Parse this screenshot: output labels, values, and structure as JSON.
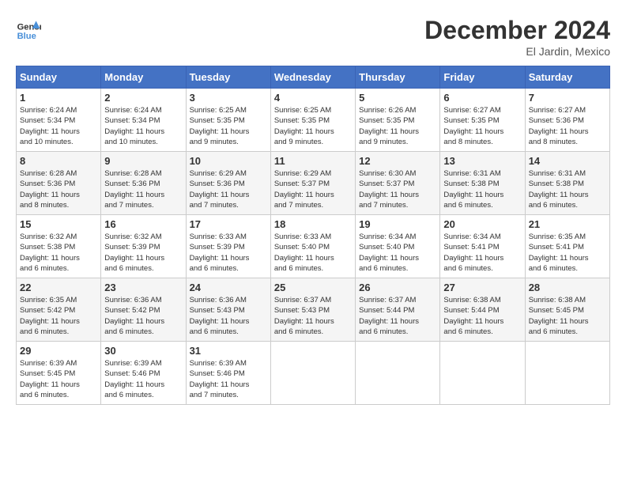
{
  "header": {
    "logo_line1": "General",
    "logo_line2": "Blue",
    "title": "December 2024",
    "subtitle": "El Jardin, Mexico"
  },
  "days_of_week": [
    "Sunday",
    "Monday",
    "Tuesday",
    "Wednesday",
    "Thursday",
    "Friday",
    "Saturday"
  ],
  "weeks": [
    [
      {
        "day": "1",
        "info": "Sunrise: 6:24 AM\nSunset: 5:34 PM\nDaylight: 11 hours\nand 10 minutes."
      },
      {
        "day": "2",
        "info": "Sunrise: 6:24 AM\nSunset: 5:34 PM\nDaylight: 11 hours\nand 10 minutes."
      },
      {
        "day": "3",
        "info": "Sunrise: 6:25 AM\nSunset: 5:35 PM\nDaylight: 11 hours\nand 9 minutes."
      },
      {
        "day": "4",
        "info": "Sunrise: 6:25 AM\nSunset: 5:35 PM\nDaylight: 11 hours\nand 9 minutes."
      },
      {
        "day": "5",
        "info": "Sunrise: 6:26 AM\nSunset: 5:35 PM\nDaylight: 11 hours\nand 9 minutes."
      },
      {
        "day": "6",
        "info": "Sunrise: 6:27 AM\nSunset: 5:35 PM\nDaylight: 11 hours\nand 8 minutes."
      },
      {
        "day": "7",
        "info": "Sunrise: 6:27 AM\nSunset: 5:36 PM\nDaylight: 11 hours\nand 8 minutes."
      }
    ],
    [
      {
        "day": "8",
        "info": "Sunrise: 6:28 AM\nSunset: 5:36 PM\nDaylight: 11 hours\nand 8 minutes."
      },
      {
        "day": "9",
        "info": "Sunrise: 6:28 AM\nSunset: 5:36 PM\nDaylight: 11 hours\nand 7 minutes."
      },
      {
        "day": "10",
        "info": "Sunrise: 6:29 AM\nSunset: 5:36 PM\nDaylight: 11 hours\nand 7 minutes."
      },
      {
        "day": "11",
        "info": "Sunrise: 6:29 AM\nSunset: 5:37 PM\nDaylight: 11 hours\nand 7 minutes."
      },
      {
        "day": "12",
        "info": "Sunrise: 6:30 AM\nSunset: 5:37 PM\nDaylight: 11 hours\nand 7 minutes."
      },
      {
        "day": "13",
        "info": "Sunrise: 6:31 AM\nSunset: 5:38 PM\nDaylight: 11 hours\nand 6 minutes."
      },
      {
        "day": "14",
        "info": "Sunrise: 6:31 AM\nSunset: 5:38 PM\nDaylight: 11 hours\nand 6 minutes."
      }
    ],
    [
      {
        "day": "15",
        "info": "Sunrise: 6:32 AM\nSunset: 5:38 PM\nDaylight: 11 hours\nand 6 minutes."
      },
      {
        "day": "16",
        "info": "Sunrise: 6:32 AM\nSunset: 5:39 PM\nDaylight: 11 hours\nand 6 minutes."
      },
      {
        "day": "17",
        "info": "Sunrise: 6:33 AM\nSunset: 5:39 PM\nDaylight: 11 hours\nand 6 minutes."
      },
      {
        "day": "18",
        "info": "Sunrise: 6:33 AM\nSunset: 5:40 PM\nDaylight: 11 hours\nand 6 minutes."
      },
      {
        "day": "19",
        "info": "Sunrise: 6:34 AM\nSunset: 5:40 PM\nDaylight: 11 hours\nand 6 minutes."
      },
      {
        "day": "20",
        "info": "Sunrise: 6:34 AM\nSunset: 5:41 PM\nDaylight: 11 hours\nand 6 minutes."
      },
      {
        "day": "21",
        "info": "Sunrise: 6:35 AM\nSunset: 5:41 PM\nDaylight: 11 hours\nand 6 minutes."
      }
    ],
    [
      {
        "day": "22",
        "info": "Sunrise: 6:35 AM\nSunset: 5:42 PM\nDaylight: 11 hours\nand 6 minutes."
      },
      {
        "day": "23",
        "info": "Sunrise: 6:36 AM\nSunset: 5:42 PM\nDaylight: 11 hours\nand 6 minutes."
      },
      {
        "day": "24",
        "info": "Sunrise: 6:36 AM\nSunset: 5:43 PM\nDaylight: 11 hours\nand 6 minutes."
      },
      {
        "day": "25",
        "info": "Sunrise: 6:37 AM\nSunset: 5:43 PM\nDaylight: 11 hours\nand 6 minutes."
      },
      {
        "day": "26",
        "info": "Sunrise: 6:37 AM\nSunset: 5:44 PM\nDaylight: 11 hours\nand 6 minutes."
      },
      {
        "day": "27",
        "info": "Sunrise: 6:38 AM\nSunset: 5:44 PM\nDaylight: 11 hours\nand 6 minutes."
      },
      {
        "day": "28",
        "info": "Sunrise: 6:38 AM\nSunset: 5:45 PM\nDaylight: 11 hours\nand 6 minutes."
      }
    ],
    [
      {
        "day": "29",
        "info": "Sunrise: 6:39 AM\nSunset: 5:45 PM\nDaylight: 11 hours\nand 6 minutes."
      },
      {
        "day": "30",
        "info": "Sunrise: 6:39 AM\nSunset: 5:46 PM\nDaylight: 11 hours\nand 6 minutes."
      },
      {
        "day": "31",
        "info": "Sunrise: 6:39 AM\nSunset: 5:46 PM\nDaylight: 11 hours\nand 7 minutes."
      },
      {
        "day": "",
        "info": ""
      },
      {
        "day": "",
        "info": ""
      },
      {
        "day": "",
        "info": ""
      },
      {
        "day": "",
        "info": ""
      }
    ]
  ]
}
